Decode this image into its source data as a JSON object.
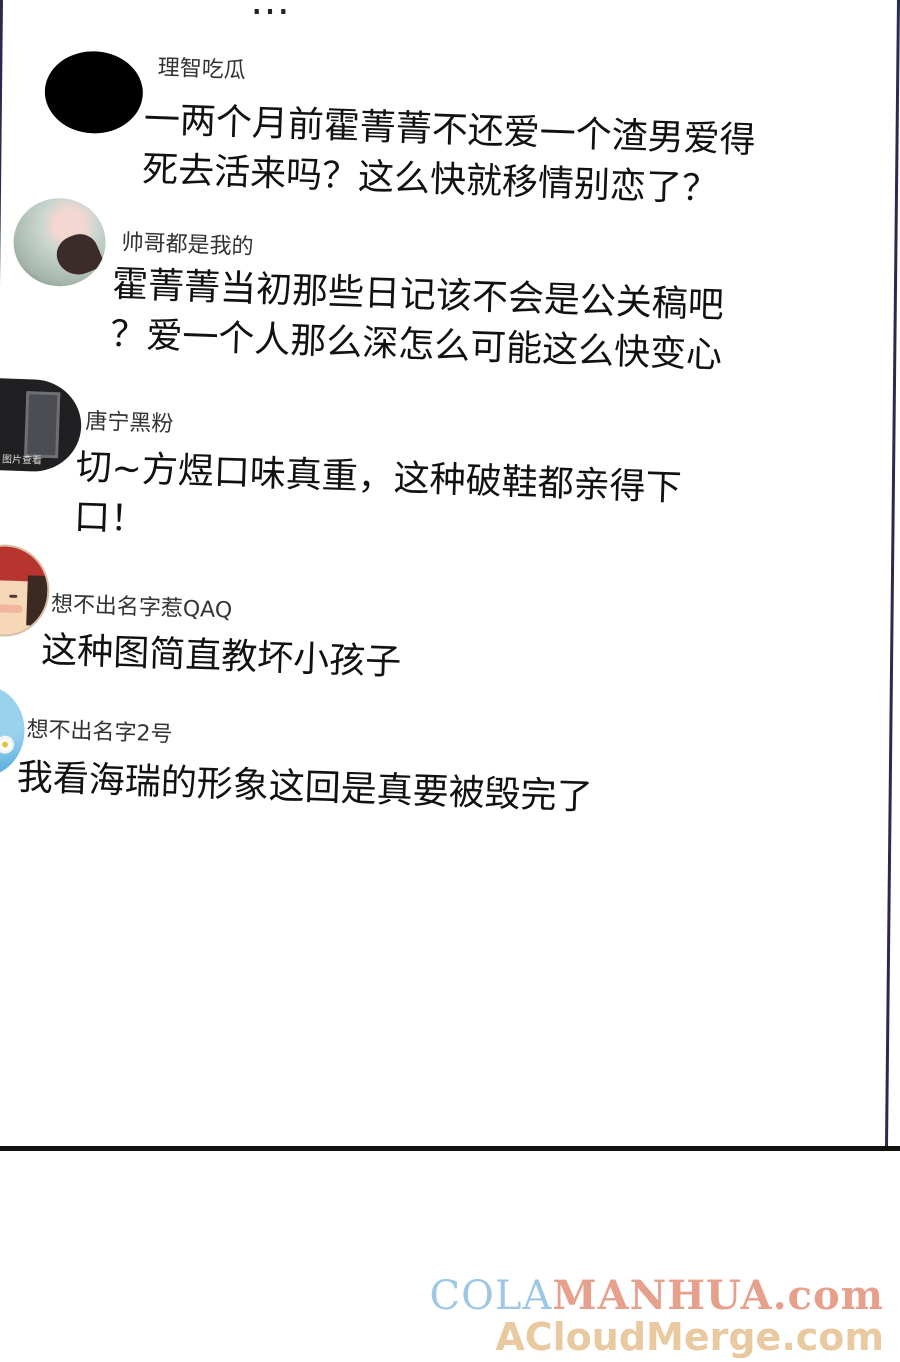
{
  "cut_off_text": "…",
  "comments": [
    {
      "username": "理智吃瓜",
      "text": "一两个月前霍菁菁不还爱一个渣男爱得\n死去活来吗？这么快就移情别恋了？"
    },
    {
      "username": "帅哥都是我的",
      "text": "霍菁菁当初那些日记该不会是公关稿吧\n？爱一个人那么深怎么可能这么快变心"
    },
    {
      "username": "唐宁黑粉",
      "avatar_caption": "图片查看",
      "text": "切~方煜口味真重，这种破鞋都亲得下\n口！"
    },
    {
      "username": "想不出名字惹QAQ",
      "text": "这种图简直教坏小孩子"
    },
    {
      "username": "想不出名字2号",
      "text": "我看海瑞的形象这回是真要被毁完了"
    }
  ],
  "watermark": {
    "line1_part1": "COLA",
    "line1_part2": "MANHUA.com",
    "line2": "ACloudMerge.com"
  }
}
